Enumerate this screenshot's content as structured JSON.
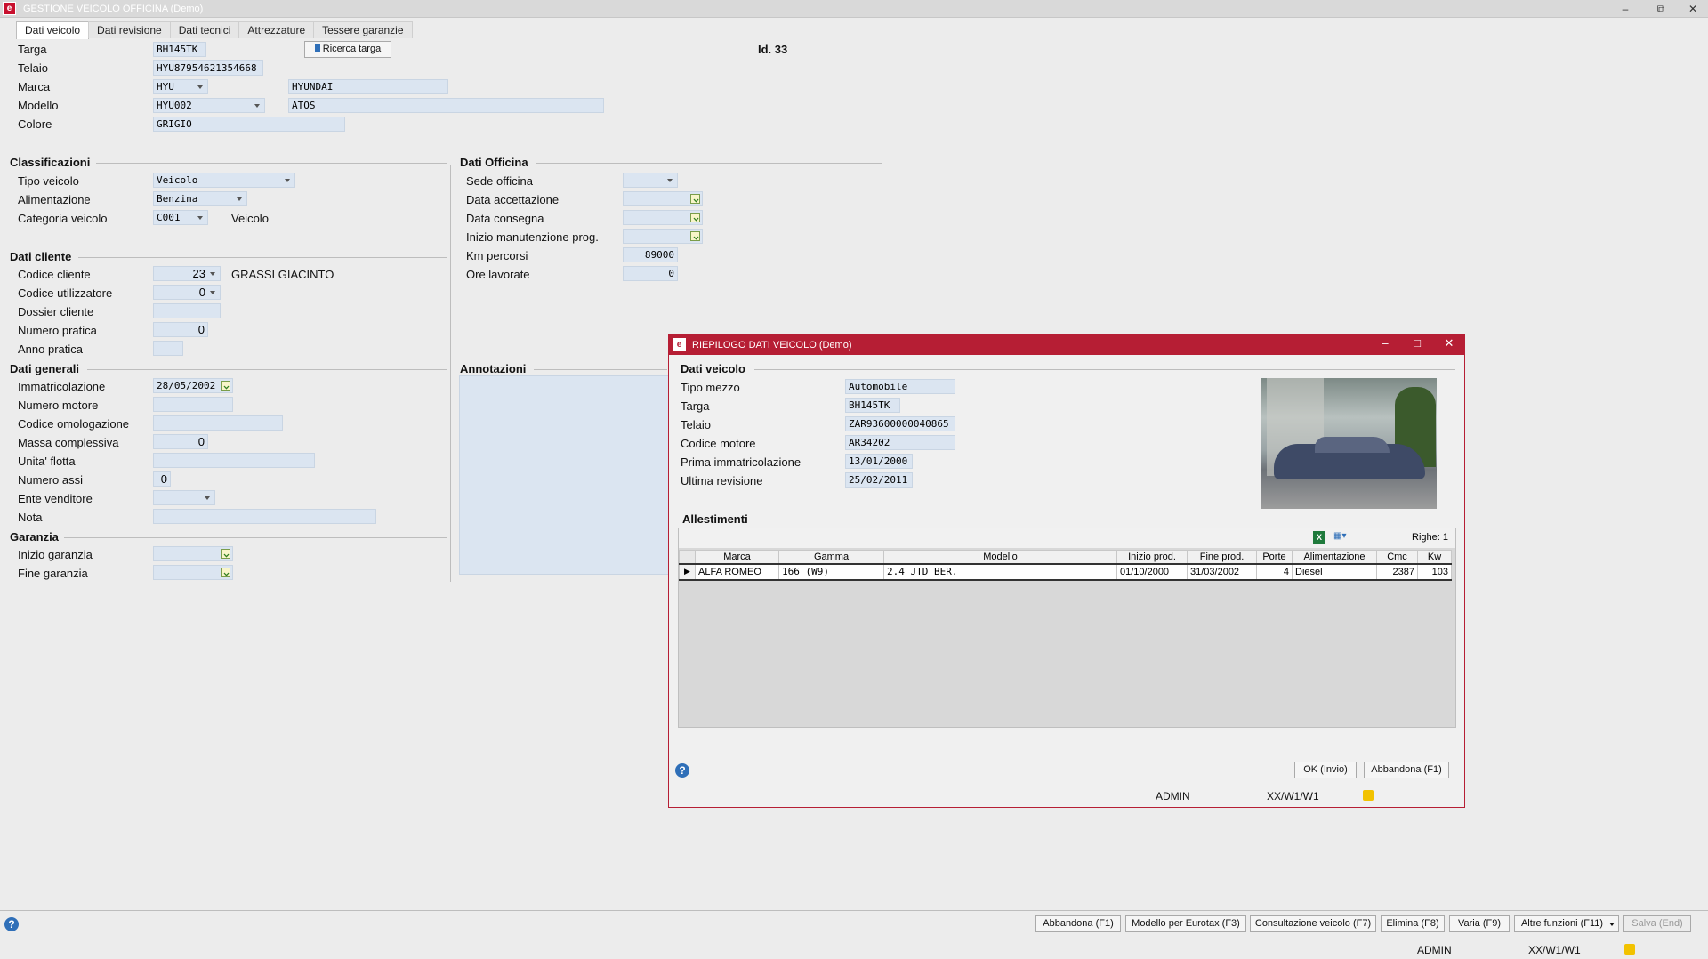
{
  "window": {
    "title": "GESTIONE VEICOLO OFFICINA  (Demo)",
    "icon": "app-logo-icon"
  },
  "tabs": [
    "Dati veicolo",
    "Dati revisione",
    "Dati tecnici",
    "Attrezzature",
    "Tessere garanzie"
  ],
  "header": {
    "targa_label": "Targa",
    "targa": "BH145TK",
    "search_button": "Ricerca targa",
    "id": "Id. 33",
    "telaio_label": "Telaio",
    "telaio": "HYU87954621354668",
    "marca_label": "Marca",
    "marca_code": "HYU",
    "marca_name": "HYUNDAI",
    "modello_label": "Modello",
    "modello_code": "HYU002",
    "modello_name": "ATOS",
    "colore_label": "Colore",
    "colore": "GRIGIO"
  },
  "classificazioni": {
    "title": "Classificazioni",
    "tipo_label": "Tipo veicolo",
    "tipo": "Veicolo",
    "alim_label": "Alimentazione",
    "alim": "Benzina",
    "cat_label": "Categoria veicolo",
    "cat_code": "C001",
    "cat_name": "Veicolo"
  },
  "dati_cliente": {
    "title": "Dati cliente",
    "codice_label": "Codice cliente",
    "codice": "23",
    "cliente_name": "GRASSI GIACINTO",
    "util_label": "Codice utilizzatore",
    "util": "0",
    "dossier_label": "Dossier cliente",
    "dossier": "",
    "pratica_label": "Numero pratica",
    "pratica": "0",
    "anno_label": "Anno pratica",
    "anno": ""
  },
  "dati_generali": {
    "title": "Dati generali",
    "immatr_label": "Immatricolazione",
    "immatr": "28/05/2002",
    "motore_label": "Numero motore",
    "motore": "",
    "omolog_label": "Codice omologazione",
    "omolog": "",
    "massa_label": "Massa complessiva",
    "massa": "0",
    "flotta_label": "Unita' flotta",
    "flotta": "",
    "assi_label": "Numero assi",
    "assi": "0",
    "vend_label": "Ente venditore",
    "vend": "",
    "nota_label": "Nota",
    "nota": ""
  },
  "garanzia": {
    "title": "Garanzia",
    "inizio_label": "Inizio garanzia",
    "inizio": "",
    "fine_label": "Fine garanzia",
    "fine": ""
  },
  "dati_officina": {
    "title": "Dati Officina",
    "sede_label": "Sede officina",
    "sede": "",
    "accett_label": "Data accettazione",
    "accett": "",
    "consegna_label": "Data consegna",
    "consegna": "",
    "manut_label": "Inizio manutenzione prog.",
    "manut": "",
    "km_label": "Km percorsi",
    "km": "89000",
    "ore_label": "Ore lavorate",
    "ore": "0"
  },
  "annotazioni": {
    "title": "Annotazioni"
  },
  "footer": {
    "buttons": [
      "Abbandona (F1)",
      "Modello per Eurotax (F3)",
      "Consultazione veicolo (F7)",
      "Elimina (F8)",
      "Varia (F9)",
      "Altre funzioni (F11)",
      "Salva (End)"
    ],
    "user": "ADMIN",
    "path": "XX/W1/W1"
  },
  "dialog": {
    "title": "RIEPILOGO DATI VEICOLO  (Demo)",
    "section": "Dati veicolo",
    "tipo_label": "Tipo mezzo",
    "tipo": "Automobile",
    "targa_label": "Targa",
    "targa": "BH145TK",
    "telaio_label": "Telaio",
    "telaio": "ZAR93600000040865",
    "motore_label": "Codice motore",
    "motore": "AR34202",
    "prima_label": "Prima immatricolazione",
    "prima": "13/01/2000",
    "ultima_label": "Ultima revisione",
    "ultima": "25/02/2011",
    "allestimenti_title": "Allestimenti",
    "righe": "Righe: 1",
    "columns": [
      "Marca",
      "Gamma",
      "Modello",
      "Inizio prod.",
      "Fine prod.",
      "Porte",
      "Alimentazione",
      "Cmc",
      "Kw"
    ],
    "rows": [
      [
        "ALFA ROMEO",
        "166 (W9)",
        "2.4 JTD BER.",
        "01/10/2000",
        "31/03/2002",
        "4",
        "Diesel",
        "2387",
        "103"
      ]
    ],
    "ok_button": "OK (Invio)",
    "cancel_button": "Abbandona (F1)",
    "user": "ADMIN",
    "path": "XX/W1/W1"
  },
  "colors": {
    "accent": "#b61e34",
    "field_bg": "#dbe5f1",
    "window_bg": "#ececec"
  }
}
